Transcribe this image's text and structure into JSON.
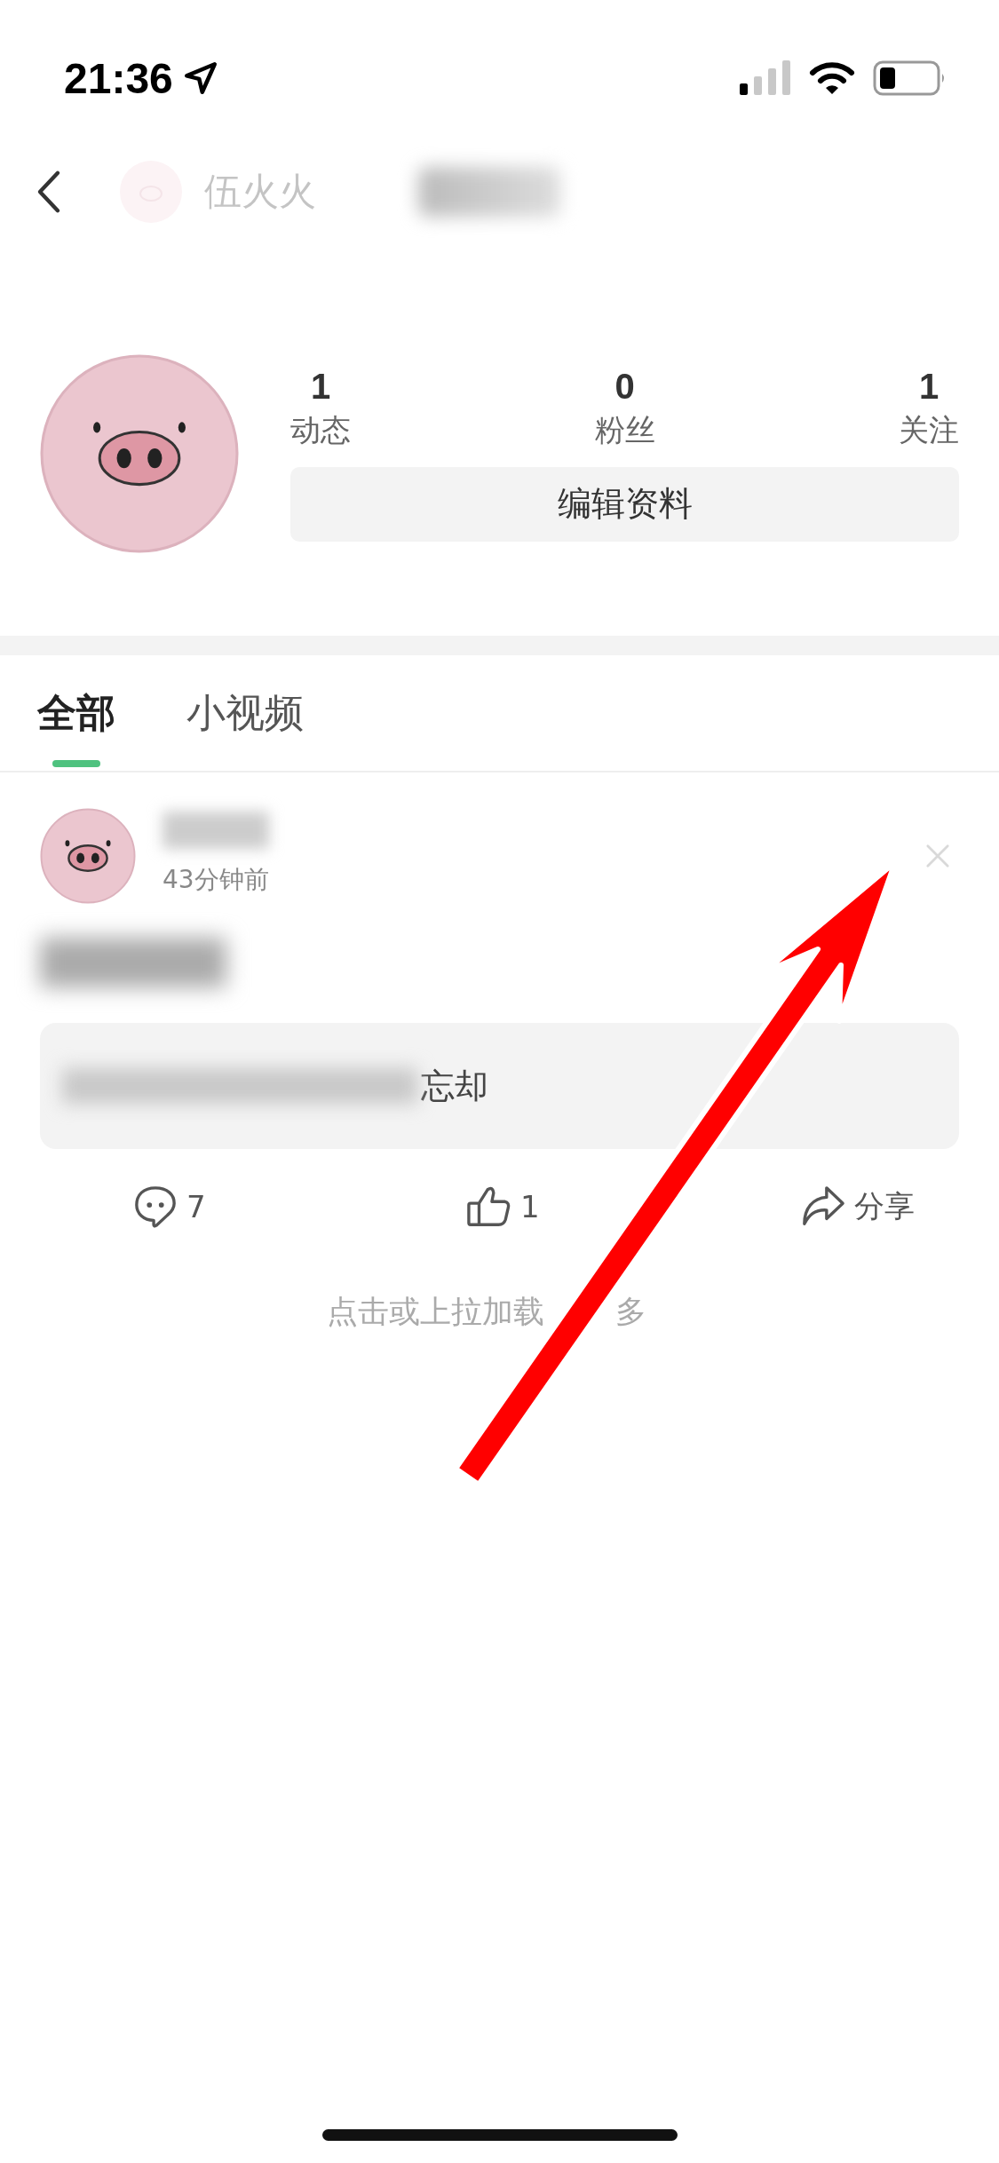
{
  "status_bar": {
    "time": "21:36"
  },
  "header": {
    "faded_name": "伍火火"
  },
  "profile": {
    "stats": [
      {
        "value": "1",
        "label": "动态"
      },
      {
        "value": "0",
        "label": "粉丝"
      },
      {
        "value": "1",
        "label": "关注"
      }
    ],
    "edit_button": "编辑资料"
  },
  "tabs": [
    {
      "label": "全部",
      "selected": true
    },
    {
      "label": "小视频",
      "selected": false
    }
  ],
  "post": {
    "time": "43分钟前",
    "quote_visible": "忘却",
    "actions": [
      {
        "kind": "comment",
        "text": "7"
      },
      {
        "kind": "like",
        "text": "1"
      },
      {
        "kind": "share",
        "text": "分享"
      }
    ]
  },
  "load_more": {
    "before": "点击或上拉加载",
    "after": "多"
  }
}
